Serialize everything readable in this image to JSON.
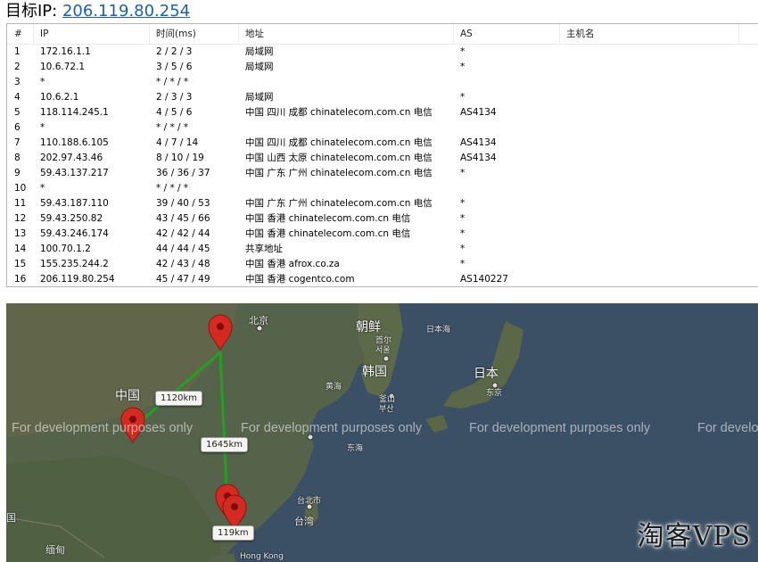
{
  "header": {
    "label": "目标IP:",
    "target_ip": "206.119.80.254"
  },
  "table": {
    "columns": [
      "#",
      "IP",
      "时间(ms)",
      "地址",
      "AS",
      "主机名"
    ],
    "rows": [
      {
        "n": "1",
        "ip": "172.16.1.1",
        "time": "2 / 2 / 3",
        "addr": "局域网",
        "as": "*",
        "host": ""
      },
      {
        "n": "2",
        "ip": "10.6.72.1",
        "time": "3 / 5 / 6",
        "addr": "局域网",
        "as": "*",
        "host": ""
      },
      {
        "n": "3",
        "ip": "*",
        "time": "* / * / *",
        "addr": "",
        "as": "",
        "host": ""
      },
      {
        "n": "4",
        "ip": "10.6.2.1",
        "time": "2 / 3 / 3",
        "addr": "局域网",
        "as": "*",
        "host": ""
      },
      {
        "n": "5",
        "ip": "118.114.245.1",
        "time": "4 / 5 / 6",
        "addr": "中国 四川 成都 chinatelecom.com.cn 电信",
        "as": "AS4134",
        "host": ""
      },
      {
        "n": "6",
        "ip": "*",
        "time": "* / * / *",
        "addr": "",
        "as": "",
        "host": ""
      },
      {
        "n": "7",
        "ip": "110.188.6.105",
        "time": "4 / 7 / 14",
        "addr": "中国 四川 成都 chinatelecom.com.cn 电信",
        "as": "AS4134",
        "host": ""
      },
      {
        "n": "8",
        "ip": "202.97.43.46",
        "time": "8 / 10 / 19",
        "addr": "中国 山西 太原 chinatelecom.com.cn 电信",
        "as": "AS4134",
        "host": ""
      },
      {
        "n": "9",
        "ip": "59.43.137.217",
        "time": "36 / 36 / 37",
        "addr": "中国 广东 广州 chinatelecom.com.cn 电信",
        "as": "*",
        "host": ""
      },
      {
        "n": "10",
        "ip": "*",
        "time": "* / * / *",
        "addr": "",
        "as": "",
        "host": ""
      },
      {
        "n": "11",
        "ip": "59.43.187.110",
        "time": "39 / 40 / 53",
        "addr": "中国 广东 广州 chinatelecom.com.cn 电信",
        "as": "*",
        "host": ""
      },
      {
        "n": "12",
        "ip": "59.43.250.82",
        "time": "43 / 45 / 66",
        "addr": "中国 香港 chinatelecom.com.cn 电信",
        "as": "*",
        "host": ""
      },
      {
        "n": "13",
        "ip": "59.43.246.174",
        "time": "42 / 42 / 44",
        "addr": "中国 香港 chinatelecom.com.cn 电信",
        "as": "*",
        "host": ""
      },
      {
        "n": "14",
        "ip": "100.70.1.2",
        "time": "44 / 44 / 45",
        "addr": "共享地址",
        "as": "*",
        "host": ""
      },
      {
        "n": "15",
        "ip": "155.235.244.2",
        "time": "42 / 43 / 48",
        "addr": "中国 香港 afrox.co.za",
        "as": "*",
        "host": ""
      },
      {
        "n": "16",
        "ip": "206.119.80.254",
        "time": "45 / 47 / 49",
        "addr": "中国 香港 cogentco.com",
        "as": "AS140227",
        "host": ""
      }
    ]
  },
  "map": {
    "distances": [
      "1120km",
      "1645km",
      "119km"
    ],
    "watermark": "For development purposes only",
    "places": {
      "china": "中国",
      "beijing": "北京",
      "korea": "韩国",
      "north_korea": "朝鲜",
      "japan": "日本",
      "tokyo": "东京",
      "seoul_a": "首尔",
      "seoul_b": "서울",
      "busan_a": "釜山",
      "busan_b": "부산",
      "taipei": "台北市",
      "taiwan": "台湾",
      "hongkong": "Hong Kong",
      "myanmar": "缅甸",
      "yellow_sea": "黄海",
      "east_sea": "东海",
      "sea_of_japan": "日本海",
      "guang": "国"
    },
    "colors": {
      "route": "#22a020",
      "marker": "#d42a22",
      "land": "#4a5a3c",
      "sea": "#3d5166"
    }
  },
  "brand": "淘客VPS"
}
